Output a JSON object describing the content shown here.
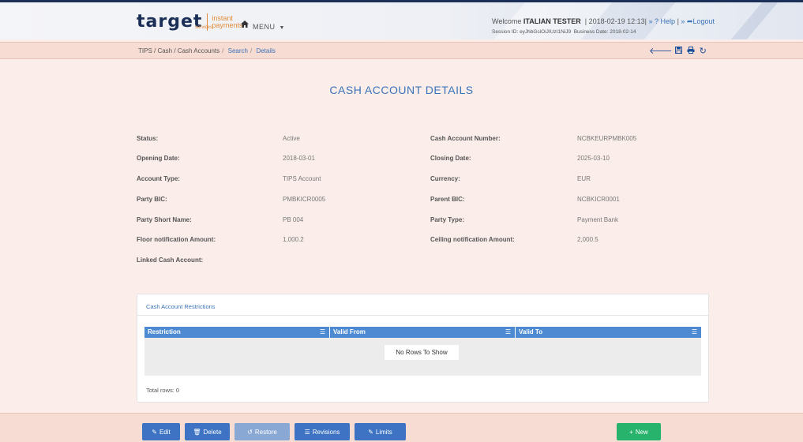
{
  "header": {
    "logo_main": "target",
    "logo_services": "services",
    "logo_sub1": "instant",
    "logo_sub2": "payments",
    "home_icon": "home-icon",
    "menu_label": "MENU",
    "welcome_prefix": "Welcome",
    "user": "ITALIAN TESTER",
    "datetime": "| 2018-02-19 12:13|",
    "help_label": "Help",
    "logout_label": "Logout",
    "session_label": "Session ID:",
    "session_id": "eyJhbGciOiJIUzI1NiJ9",
    "business_date_label": "Business Date:",
    "business_date": "2018-02-14"
  },
  "breadcrumb": {
    "path": "TIPS / Cash / Cash Accounts",
    "search": "Search",
    "details": "Details"
  },
  "toolbar_icons": [
    "back-arrow-icon",
    "save-icon",
    "print-icon",
    "refresh-icon"
  ],
  "page_title": "CASH ACCOUNT DETAILS",
  "fields": {
    "status": {
      "label": "Status:",
      "value": "Active"
    },
    "cash_account_number": {
      "label": "Cash Account Number:",
      "value": "NCBKEURPMBK005"
    },
    "opening_date": {
      "label": "Opening Date:",
      "value": "2018-03-01"
    },
    "closing_date": {
      "label": "Closing Date:",
      "value": "2025-03-10"
    },
    "account_type": {
      "label": "Account Type:",
      "value": "TIPS Account"
    },
    "currency": {
      "label": "Currency:",
      "value": "EUR"
    },
    "party_bic": {
      "label": "Party BIC:",
      "value": "PMBKICR0005"
    },
    "parent_bic": {
      "label": "Parent BIC:",
      "value": "NCBKICR0001"
    },
    "party_short_name": {
      "label": "Party Short Name:",
      "value": "PB 004"
    },
    "party_type": {
      "label": "Party Type:",
      "value": "Payment Bank"
    },
    "floor_notification": {
      "label": "Floor notification Amount:",
      "value": "1,000.2"
    },
    "ceiling_notification": {
      "label": "Ceiling notification Amount:",
      "value": "2,000.5"
    },
    "linked_cash_account": {
      "label": "Linked Cash Account:",
      "value": ""
    }
  },
  "restrictions": {
    "title": "Cash Account Restrictions",
    "columns": [
      "Restriction",
      "Valid From",
      "Valid To"
    ],
    "empty_message": "No Rows To Show",
    "total_label": "Total rows: 0"
  },
  "buttons": {
    "edit": "Edit",
    "delete": "Delete",
    "restore": "Restore",
    "revisions": "Revisions",
    "limits": "Limits",
    "new": "New"
  },
  "colors": {
    "accent_blue": "#3a73b9",
    "navy": "#1b2f57",
    "brand_orange": "#e28c3a",
    "grid_header": "#4d8ad1",
    "button_blue": "#3d73c2",
    "button_green": "#27b36b",
    "bar_pink": "#f7dcd3",
    "page_bg": "#fbeeea"
  }
}
